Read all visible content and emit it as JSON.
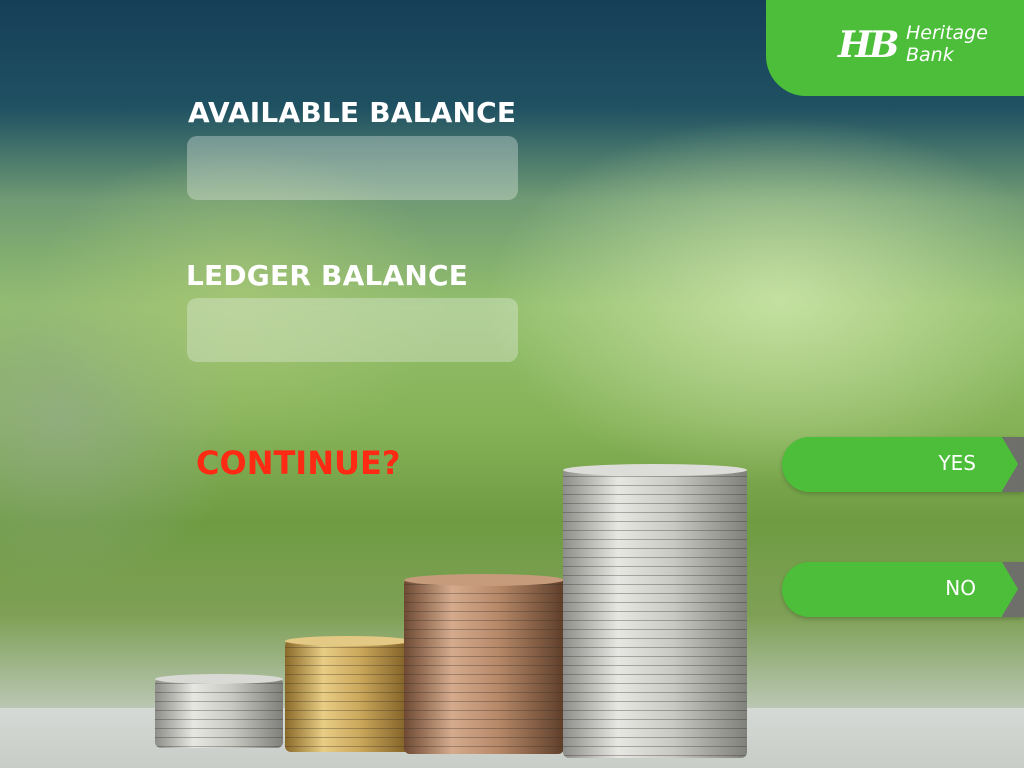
{
  "brand": {
    "mark": "HB",
    "name_line1": "Heritage",
    "name_line2": "Bank",
    "color": "#4cbe3a"
  },
  "balances": {
    "available_label": "AVAILABLE BALANCE",
    "available_value": "",
    "ledger_label": "LEDGER BALANCE",
    "ledger_value": ""
  },
  "prompt": {
    "text": "CONTINUE?",
    "color": "#ff2a13"
  },
  "options": {
    "yes_label": "YES",
    "no_label": "NO"
  },
  "icons": [
    "hb-logo-icon",
    "arrow-right-icon"
  ]
}
